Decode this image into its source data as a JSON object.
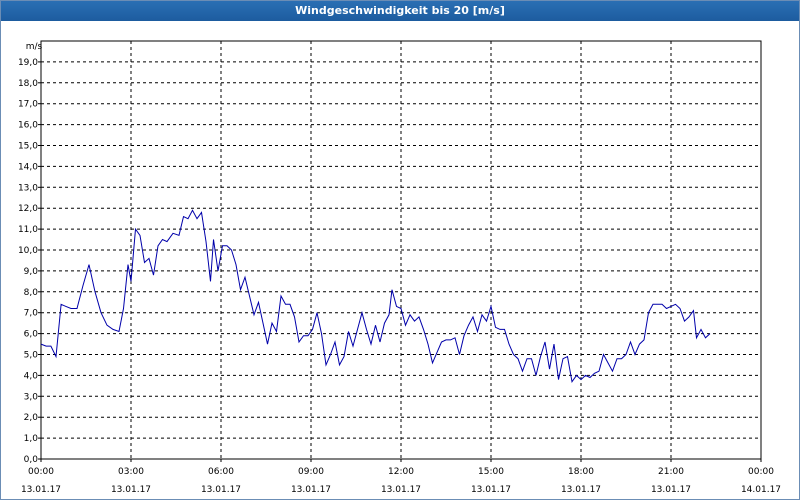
{
  "window": {
    "title": "Windgeschwindigkeit bis 20 [m/s]"
  },
  "chart_data": {
    "type": "line",
    "title": "Windgeschwindigkeit bis 20 [m/s]",
    "ylabel": "m/s",
    "ylim": [
      0,
      20
    ],
    "xlim_hours": [
      0,
      24
    ],
    "grid": true,
    "line_color": "#0000aa",
    "y_ticks": [
      "0,0",
      "1,0",
      "2,0",
      "3,0",
      "4,0",
      "5,0",
      "6,0",
      "7,0",
      "8,0",
      "9,0",
      "10,0",
      "11,0",
      "12,0",
      "13,0",
      "14,0",
      "15,0",
      "16,0",
      "17,0",
      "18,0",
      "19,0"
    ],
    "x_ticks": [
      {
        "time": "00:00",
        "date": "13.01.17"
      },
      {
        "time": "03:00",
        "date": "13.01.17"
      },
      {
        "time": "06:00",
        "date": "13.01.17"
      },
      {
        "time": "09:00",
        "date": "13.01.17"
      },
      {
        "time": "12:00",
        "date": "13.01.17"
      },
      {
        "time": "15:00",
        "date": "13.01.17"
      },
      {
        "time": "18:00",
        "date": "13.01.17"
      },
      {
        "time": "21:00",
        "date": "13.01.17"
      },
      {
        "time": "00:00",
        "date": "14.01.17"
      }
    ],
    "series": [
      {
        "values": [
          [
            0.0,
            5.5
          ],
          [
            0.17,
            5.4
          ],
          [
            0.33,
            5.4
          ],
          [
            0.5,
            4.9
          ],
          [
            0.67,
            7.4
          ],
          [
            0.83,
            7.3
          ],
          [
            1.0,
            7.2
          ],
          [
            1.2,
            7.2
          ],
          [
            1.4,
            8.3
          ],
          [
            1.6,
            9.3
          ],
          [
            1.8,
            8.0
          ],
          [
            2.0,
            7.0
          ],
          [
            2.2,
            6.4
          ],
          [
            2.4,
            6.2
          ],
          [
            2.6,
            6.1
          ],
          [
            2.75,
            7.2
          ],
          [
            2.9,
            9.3
          ],
          [
            3.0,
            8.5
          ],
          [
            3.15,
            11.0
          ],
          [
            3.3,
            10.7
          ],
          [
            3.45,
            9.4
          ],
          [
            3.6,
            9.6
          ],
          [
            3.75,
            8.8
          ],
          [
            3.9,
            10.2
          ],
          [
            4.05,
            10.5
          ],
          [
            4.2,
            10.4
          ],
          [
            4.4,
            10.8
          ],
          [
            4.6,
            10.7
          ],
          [
            4.75,
            11.6
          ],
          [
            4.9,
            11.5
          ],
          [
            5.05,
            11.9
          ],
          [
            5.2,
            11.5
          ],
          [
            5.35,
            11.8
          ],
          [
            5.5,
            10.4
          ],
          [
            5.65,
            8.5
          ],
          [
            5.75,
            10.5
          ],
          [
            5.9,
            9.0
          ],
          [
            6.05,
            10.2
          ],
          [
            6.2,
            10.2
          ],
          [
            6.35,
            10.0
          ],
          [
            6.5,
            9.3
          ],
          [
            6.65,
            8.1
          ],
          [
            6.8,
            8.7
          ],
          [
            6.95,
            7.8
          ],
          [
            7.1,
            6.9
          ],
          [
            7.25,
            7.5
          ],
          [
            7.4,
            6.5
          ],
          [
            7.55,
            5.5
          ],
          [
            7.7,
            6.5
          ],
          [
            7.85,
            6.1
          ],
          [
            8.0,
            7.8
          ],
          [
            8.15,
            7.4
          ],
          [
            8.3,
            7.4
          ],
          [
            8.45,
            6.8
          ],
          [
            8.6,
            5.6
          ],
          [
            8.75,
            5.9
          ],
          [
            8.9,
            5.9
          ],
          [
            9.05,
            6.2
          ],
          [
            9.2,
            7.0
          ],
          [
            9.35,
            6.0
          ],
          [
            9.5,
            4.5
          ],
          [
            9.65,
            5.0
          ],
          [
            9.8,
            5.6
          ],
          [
            9.95,
            4.5
          ],
          [
            10.1,
            4.9
          ],
          [
            10.25,
            6.1
          ],
          [
            10.4,
            5.4
          ],
          [
            10.55,
            6.2
          ],
          [
            10.7,
            7.0
          ],
          [
            10.85,
            6.2
          ],
          [
            11.0,
            5.5
          ],
          [
            11.15,
            6.4
          ],
          [
            11.3,
            5.6
          ],
          [
            11.45,
            6.5
          ],
          [
            11.6,
            6.9
          ],
          [
            11.7,
            8.1
          ],
          [
            11.85,
            7.3
          ],
          [
            12.0,
            7.2
          ],
          [
            12.15,
            6.4
          ],
          [
            12.3,
            6.9
          ],
          [
            12.45,
            6.6
          ],
          [
            12.6,
            6.8
          ],
          [
            12.75,
            6.2
          ],
          [
            12.9,
            5.5
          ],
          [
            13.05,
            4.6
          ],
          [
            13.2,
            5.1
          ],
          [
            13.35,
            5.6
          ],
          [
            13.5,
            5.7
          ],
          [
            13.65,
            5.7
          ],
          [
            13.8,
            5.8
          ],
          [
            13.95,
            5.0
          ],
          [
            14.1,
            5.9
          ],
          [
            14.25,
            6.4
          ],
          [
            14.4,
            6.8
          ],
          [
            14.55,
            6.1
          ],
          [
            14.7,
            6.9
          ],
          [
            14.85,
            6.6
          ],
          [
            15.0,
            7.3
          ],
          [
            15.15,
            6.3
          ],
          [
            15.3,
            6.2
          ],
          [
            15.45,
            6.2
          ],
          [
            15.6,
            5.5
          ],
          [
            15.75,
            5.0
          ],
          [
            15.9,
            4.8
          ],
          [
            16.05,
            4.2
          ],
          [
            16.2,
            4.8
          ],
          [
            16.35,
            4.8
          ],
          [
            16.5,
            4.0
          ],
          [
            16.65,
            4.9
          ],
          [
            16.8,
            5.6
          ],
          [
            16.95,
            4.3
          ],
          [
            17.1,
            5.5
          ],
          [
            17.25,
            3.8
          ],
          [
            17.4,
            4.8
          ],
          [
            17.55,
            4.9
          ],
          [
            17.7,
            3.7
          ],
          [
            17.85,
            4.0
          ],
          [
            18.0,
            3.8
          ],
          [
            18.15,
            4.0
          ],
          [
            18.3,
            3.9
          ],
          [
            18.45,
            4.1
          ],
          [
            18.6,
            4.2
          ],
          [
            18.75,
            5.0
          ],
          [
            18.9,
            4.6
          ],
          [
            19.05,
            4.2
          ],
          [
            19.2,
            4.8
          ],
          [
            19.35,
            4.8
          ],
          [
            19.5,
            5.0
          ],
          [
            19.65,
            5.6
          ],
          [
            19.8,
            5.0
          ],
          [
            19.95,
            5.5
          ],
          [
            20.1,
            5.7
          ],
          [
            20.25,
            7.0
          ],
          [
            20.4,
            7.4
          ],
          [
            20.55,
            7.4
          ],
          [
            20.7,
            7.4
          ],
          [
            20.85,
            7.2
          ],
          [
            21.0,
            7.3
          ],
          [
            21.15,
            7.4
          ],
          [
            21.3,
            7.2
          ],
          [
            21.45,
            6.6
          ],
          [
            21.6,
            6.8
          ],
          [
            21.75,
            7.1
          ],
          [
            21.85,
            5.8
          ],
          [
            22.0,
            6.2
          ],
          [
            22.15,
            5.8
          ],
          [
            22.3,
            6.0
          ]
        ]
      }
    ]
  }
}
